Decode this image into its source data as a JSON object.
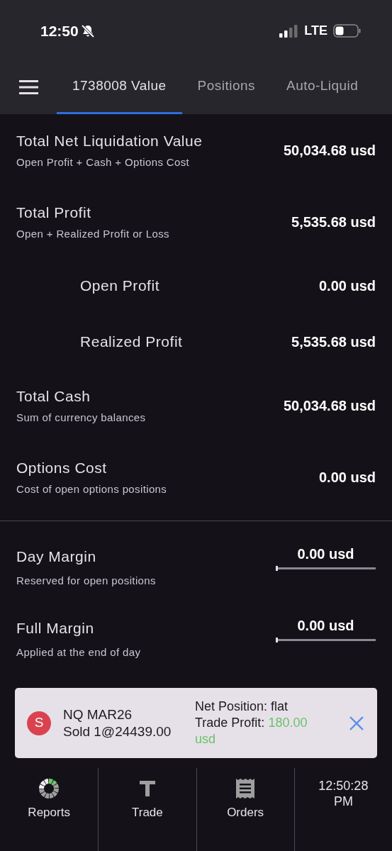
{
  "status_bar": {
    "time": "12:50",
    "network": "LTE"
  },
  "tabs": [
    {
      "label": "1738008 Value",
      "selected": true
    },
    {
      "label": "Positions",
      "selected": false
    },
    {
      "label": "Auto-Liquid",
      "selected": false
    }
  ],
  "rows": [
    {
      "kind": "value",
      "title": "Total Net Liquidation Value",
      "subtitle": "Open Profit + Cash + Options Cost",
      "value": "50,034.68 usd"
    },
    {
      "kind": "value",
      "title": "Total Profit",
      "subtitle": "Open + Realized Profit or Loss",
      "value": "5,535.68 usd"
    },
    {
      "kind": "sub",
      "title": "Open Profit",
      "value": "0.00 usd"
    },
    {
      "kind": "sub",
      "title": "Realized Profit",
      "value": "5,535.68 usd"
    },
    {
      "kind": "value",
      "title": "Total Cash",
      "subtitle": "Sum of currency balances",
      "value": "50,034.68 usd"
    },
    {
      "kind": "value",
      "title": "Options Cost",
      "subtitle": "Cost of open options positions",
      "value": "0.00 usd"
    },
    {
      "kind": "divider"
    },
    {
      "kind": "margin",
      "title": "Day Margin",
      "subtitle": "Reserved for open positions",
      "value": "0.00 usd",
      "level": 0
    },
    {
      "kind": "margin",
      "title": "Full Margin",
      "subtitle": "Applied at the end of day",
      "value": "0.00 usd",
      "level": 0
    }
  ],
  "toast": {
    "badge": "S",
    "symbol": "NQ MAR26",
    "fill": "Sold 1@24439.00",
    "net_position": "Net Position: flat",
    "profit_label": "Trade Profit:",
    "profit_value": "180.00 usd"
  },
  "nav": [
    {
      "kind": "reports",
      "label": "Reports"
    },
    {
      "kind": "trade",
      "label": "Trade"
    },
    {
      "kind": "orders",
      "label": "Orders"
    },
    {
      "kind": "clock",
      "label": "12:50:28 PM"
    }
  ]
}
